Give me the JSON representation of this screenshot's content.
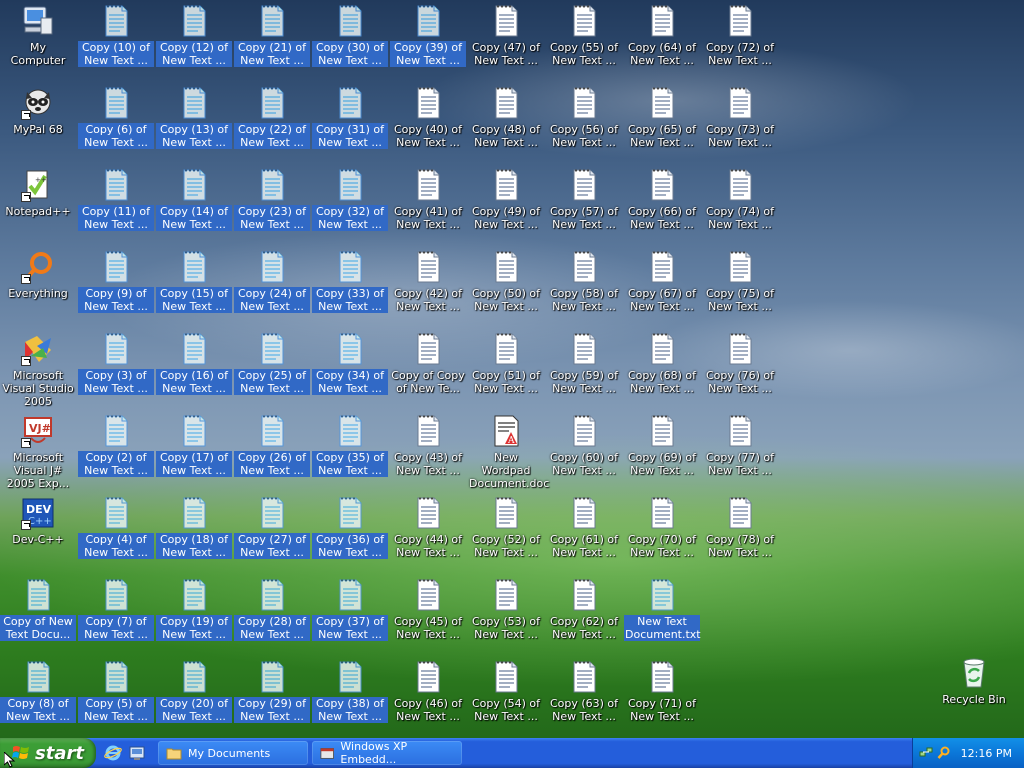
{
  "desktop_left_icons": [
    {
      "label": "My Computer",
      "icon": "my-computer-icon",
      "shortcut": false
    },
    {
      "label": "MyPal 68",
      "icon": "mypal-raccoon-icon",
      "shortcut": true
    },
    {
      "label": "Notepad++",
      "icon": "notepad-plus-plus-icon",
      "shortcut": true
    },
    {
      "label": "Everything",
      "icon": "everything-search-icon",
      "shortcut": true
    },
    {
      "label": "Microsoft Visual Studio 2005",
      "icon": "visual-studio-icon",
      "shortcut": true
    },
    {
      "label": "Microsoft Visual J# 2005 Exp...",
      "icon": "visual-jsharp-icon",
      "shortcut": true
    },
    {
      "label": "Dev-C++",
      "icon": "devcpp-icon",
      "shortcut": true
    }
  ],
  "file_columns": [
    [
      {
        "label": "Copy of New Text Docu...",
        "selected": true,
        "type": "text"
      },
      {
        "label": "Copy (8) of New Text ...",
        "selected": true,
        "type": "text"
      }
    ],
    [
      {
        "label": "Copy (10) of New Text ...",
        "selected": true,
        "type": "text"
      },
      {
        "label": "Copy (6) of New Text ...",
        "selected": true,
        "type": "text"
      },
      {
        "label": "Copy (11) of New Text ...",
        "selected": true,
        "type": "text"
      },
      {
        "label": "Copy (9) of New Text ...",
        "selected": true,
        "type": "text"
      },
      {
        "label": "Copy (3) of New Text ...",
        "selected": true,
        "type": "text"
      },
      {
        "label": "Copy (2) of New Text ...",
        "selected": true,
        "type": "text"
      },
      {
        "label": "Copy (4) of New Text ...",
        "selected": true,
        "type": "text"
      },
      {
        "label": "Copy (7) of New Text ...",
        "selected": true,
        "type": "text"
      },
      {
        "label": "Copy (5) of New Text ...",
        "selected": true,
        "type": "text"
      }
    ],
    [
      {
        "label": "Copy (12) of New Text ...",
        "selected": true,
        "type": "text"
      },
      {
        "label": "Copy (13) of New Text ...",
        "selected": true,
        "type": "text"
      },
      {
        "label": "Copy (14) of New Text ...",
        "selected": true,
        "type": "text"
      },
      {
        "label": "Copy (15) of New Text ...",
        "selected": true,
        "type": "text"
      },
      {
        "label": "Copy (16) of New Text ...",
        "selected": true,
        "type": "text"
      },
      {
        "label": "Copy (17) of New Text ...",
        "selected": true,
        "type": "text"
      },
      {
        "label": "Copy (18) of New Text ...",
        "selected": true,
        "type": "text"
      },
      {
        "label": "Copy (19) of New Text ...",
        "selected": true,
        "type": "text"
      },
      {
        "label": "Copy (20) of New Text ...",
        "selected": true,
        "type": "text"
      }
    ],
    [
      {
        "label": "Copy (21) of New Text ...",
        "selected": true,
        "type": "text"
      },
      {
        "label": "Copy (22) of New Text ...",
        "selected": true,
        "type": "text"
      },
      {
        "label": "Copy (23) of New Text ...",
        "selected": true,
        "type": "text"
      },
      {
        "label": "Copy (24) of New Text ...",
        "selected": true,
        "type": "text"
      },
      {
        "label": "Copy (25) of New Text ...",
        "selected": true,
        "type": "text"
      },
      {
        "label": "Copy (26) of New Text ...",
        "selected": true,
        "type": "text"
      },
      {
        "label": "Copy (27) of New Text ...",
        "selected": true,
        "type": "text"
      },
      {
        "label": "Copy (28) of New Text ...",
        "selected": true,
        "type": "text"
      },
      {
        "label": "Copy (29) of New Text ...",
        "selected": true,
        "type": "text"
      }
    ],
    [
      {
        "label": "Copy (30) of New Text ...",
        "selected": true,
        "type": "text"
      },
      {
        "label": "Copy (31) of New Text ...",
        "selected": true,
        "type": "text"
      },
      {
        "label": "Copy (32) of New Text ...",
        "selected": true,
        "type": "text"
      },
      {
        "label": "Copy (33) of New Text ...",
        "selected": true,
        "type": "text"
      },
      {
        "label": "Copy (34) of New Text ...",
        "selected": true,
        "type": "text"
      },
      {
        "label": "Copy (35) of New Text ...",
        "selected": true,
        "type": "text"
      },
      {
        "label": "Copy (36) of New Text ...",
        "selected": true,
        "type": "text"
      },
      {
        "label": "Copy (37) of New Text ...",
        "selected": true,
        "type": "text"
      },
      {
        "label": "Copy (38) of New Text ...",
        "selected": true,
        "type": "text"
      }
    ],
    [
      {
        "label": "Copy (39) of New Text ...",
        "selected": true,
        "type": "text"
      },
      {
        "label": "Copy (40) of New Text ...",
        "selected": false,
        "type": "text"
      },
      {
        "label": "Copy (41) of New Text ...",
        "selected": false,
        "type": "text"
      },
      {
        "label": "Copy (42) of New Text ...",
        "selected": false,
        "type": "text"
      },
      {
        "label": "Copy of Copy of New Te...",
        "selected": false,
        "type": "text"
      },
      {
        "label": "Copy (43) of New Text ...",
        "selected": false,
        "type": "text"
      },
      {
        "label": "Copy (44) of New Text ...",
        "selected": false,
        "type": "text"
      },
      {
        "label": "Copy (45) of New Text ...",
        "selected": false,
        "type": "text"
      },
      {
        "label": "Copy (46) of New Text ...",
        "selected": false,
        "type": "text"
      }
    ],
    [
      {
        "label": "Copy (47) of New Text ...",
        "selected": false,
        "type": "text"
      },
      {
        "label": "Copy (48) of New Text ...",
        "selected": false,
        "type": "text"
      },
      {
        "label": "Copy (49) of New Text ...",
        "selected": false,
        "type": "text"
      },
      {
        "label": "Copy (50) of New Text ...",
        "selected": false,
        "type": "text"
      },
      {
        "label": "Copy (51) of New Text ...",
        "selected": false,
        "type": "text"
      },
      {
        "label": "New Wordpad Document.doc",
        "selected": false,
        "type": "wordpad"
      },
      {
        "label": "Copy (52) of New Text ...",
        "selected": false,
        "type": "text"
      },
      {
        "label": "Copy (53) of New Text ...",
        "selected": false,
        "type": "text"
      },
      {
        "label": "Copy (54) of New Text ...",
        "selected": false,
        "type": "text"
      }
    ],
    [
      {
        "label": "Copy (55) of New Text ...",
        "selected": false,
        "type": "text"
      },
      {
        "label": "Copy (56) of New Text ...",
        "selected": false,
        "type": "text"
      },
      {
        "label": "Copy (57) of New Text ...",
        "selected": false,
        "type": "text"
      },
      {
        "label": "Copy (58) of New Text ...",
        "selected": false,
        "type": "text"
      },
      {
        "label": "Copy (59) of New Text ...",
        "selected": false,
        "type": "text"
      },
      {
        "label": "Copy (60) of New Text ...",
        "selected": false,
        "type": "text"
      },
      {
        "label": "Copy (61) of New Text ...",
        "selected": false,
        "type": "text"
      },
      {
        "label": "Copy (62) of New Text ...",
        "selected": false,
        "type": "text"
      },
      {
        "label": "Copy (63) of New Text ...",
        "selected": false,
        "type": "text"
      }
    ],
    [
      {
        "label": "Copy (64) of New Text ...",
        "selected": false,
        "type": "text"
      },
      {
        "label": "Copy (65) of New Text ...",
        "selected": false,
        "type": "text"
      },
      {
        "label": "Copy (66) of New Text ...",
        "selected": false,
        "type": "text"
      },
      {
        "label": "Copy (67) of New Text ...",
        "selected": false,
        "type": "text"
      },
      {
        "label": "Copy (68) of New Text ...",
        "selected": false,
        "type": "text"
      },
      {
        "label": "Copy (69) of New Text ...",
        "selected": false,
        "type": "text"
      },
      {
        "label": "Copy (70) of New Text ...",
        "selected": false,
        "type": "text"
      },
      {
        "label": "New Text Document.txt",
        "selected": true,
        "type": "text"
      },
      {
        "label": "Copy (71) of New Text ...",
        "selected": false,
        "type": "text"
      }
    ],
    [
      {
        "label": "Copy (72) of New Text ...",
        "selected": false,
        "type": "text"
      },
      {
        "label": "Copy (73) of New Text ...",
        "selected": false,
        "type": "text"
      },
      {
        "label": "Copy (74) of New Text ...",
        "selected": false,
        "type": "text"
      },
      {
        "label": "Copy (75) of New Text ...",
        "selected": false,
        "type": "text"
      },
      {
        "label": "Copy (76) of New Text ...",
        "selected": false,
        "type": "text"
      },
      {
        "label": "Copy (77) of New Text ...",
        "selected": false,
        "type": "text"
      },
      {
        "label": "Copy (78) of New Text ...",
        "selected": false,
        "type": "text"
      }
    ]
  ],
  "recycle_bin": {
    "label": "Recycle Bin",
    "icon": "recycle-bin-icon"
  },
  "taskbar": {
    "start_label": "start",
    "quick_launch": [
      {
        "icon": "internet-explorer-icon"
      },
      {
        "icon": "show-desktop-icon"
      }
    ],
    "tasks": [
      {
        "label": "My Documents",
        "icon": "folder-icon"
      },
      {
        "label": "Windows XP Embedd...",
        "icon": "app-window-icon"
      }
    ],
    "tray": {
      "clock": "12:16 PM",
      "icons": [
        "network-icon",
        "search-tray-icon"
      ]
    }
  },
  "colors": {
    "selection": "#3169c6",
    "taskbar": "#245edb",
    "start": "#3c9e36",
    "tray": "#0b77d9"
  }
}
